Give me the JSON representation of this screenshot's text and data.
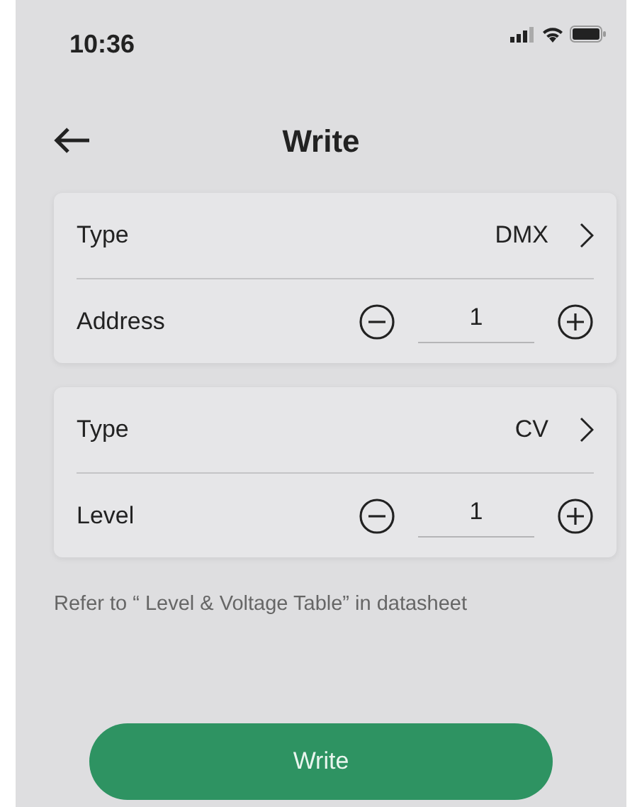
{
  "status_bar": {
    "time": "10:36"
  },
  "header": {
    "title": "Write"
  },
  "cards": [
    {
      "rows": [
        {
          "kind": "select",
          "label": "Type",
          "value": "DMX"
        },
        {
          "kind": "stepper",
          "label": "Address",
          "value": "1"
        }
      ]
    },
    {
      "rows": [
        {
          "kind": "select",
          "label": "Type",
          "value": "CV"
        },
        {
          "kind": "stepper",
          "label": "Level",
          "value": "1"
        }
      ]
    }
  ],
  "note": "Refer to “ Level & Voltage Table” in datasheet",
  "button": "Write"
}
